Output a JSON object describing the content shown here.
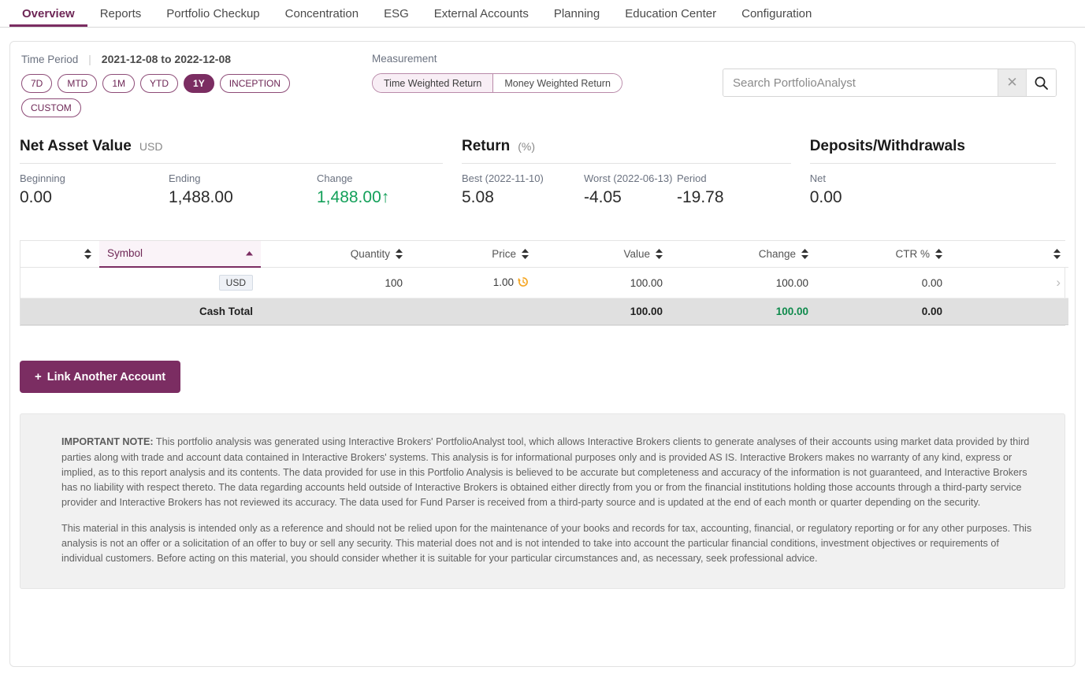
{
  "tabs": [
    {
      "label": "Overview",
      "active": true
    },
    {
      "label": "Reports",
      "active": false
    },
    {
      "label": "Portfolio Checkup",
      "active": false
    },
    {
      "label": "Concentration",
      "active": false
    },
    {
      "label": "ESG",
      "active": false
    },
    {
      "label": "External Accounts",
      "active": false
    },
    {
      "label": "Planning",
      "active": false
    },
    {
      "label": "Education Center",
      "active": false
    },
    {
      "label": "Configuration",
      "active": false
    }
  ],
  "time_period": {
    "label": "Time Period",
    "range": "2021-12-08 to 2022-12-08",
    "chips": [
      "7D",
      "MTD",
      "1M",
      "YTD",
      "1Y",
      "INCEPTION",
      "CUSTOM"
    ],
    "selected": "1Y"
  },
  "measurement": {
    "label": "Measurement",
    "options": [
      "Time Weighted Return",
      "Money Weighted Return"
    ],
    "selected": "Time Weighted Return"
  },
  "search": {
    "placeholder": "Search PortfolioAnalyst",
    "value": "",
    "clear_icon": "close-icon",
    "search_icon": "search-icon"
  },
  "summary": {
    "nav": {
      "title": "Net Asset Value",
      "unit": "USD",
      "items": [
        {
          "label": "Beginning",
          "value": "0.00",
          "positive": false
        },
        {
          "label": "Ending",
          "value": "1,488.00",
          "positive": false
        },
        {
          "label": "Change",
          "value": "1,488.00↑",
          "positive": true
        }
      ]
    },
    "ret": {
      "title": "Return",
      "unit": "(%)",
      "items": [
        {
          "label": "Best (2022-11-10)",
          "value": "5.08",
          "positive": false
        },
        {
          "label": "Worst (2022-06-13)",
          "value": "-4.05",
          "positive": false
        },
        {
          "label": "Period",
          "value": "-19.78",
          "positive": false
        }
      ]
    },
    "dep": {
      "title": "Deposits/Withdrawals",
      "unit": "",
      "items": [
        {
          "label": "Net",
          "value": "0.00",
          "positive": false
        }
      ]
    }
  },
  "table": {
    "columns": [
      "Symbol",
      "Quantity",
      "Price",
      "Value",
      "Change",
      "CTR %"
    ],
    "sorted_column": "Symbol",
    "sort_direction": "asc",
    "rows": [
      {
        "symbol": "USD",
        "quantity": "100",
        "price": "1.00",
        "price_icon": "history-icon",
        "value": "100.00",
        "change": "100.00",
        "ctr": "0.00",
        "expand_icon": "chevron-right-icon"
      }
    ],
    "total_row": {
      "label": "Cash Total",
      "quantity": "",
      "price": "",
      "value": "100.00",
      "change": "100.00",
      "ctr": "0.00"
    }
  },
  "link_button": {
    "label": "Link Another Account",
    "icon": "plus-icon"
  },
  "disclaimer": {
    "heading": "IMPORTANT NOTE:",
    "paragraph1": " This portfolio analysis was generated using Interactive Brokers' PortfolioAnalyst tool, which allows Interactive Brokers clients to generate analyses of their accounts using market data provided by third parties along with trade and account data contained in Interactive Brokers' systems. This analysis is for informational purposes only and is provided AS IS. Interactive Brokers makes no warranty of any kind, express or implied, as to this report analysis and its contents. The data provided for use in this Portfolio Analysis is believed to be accurate but completeness and accuracy of the information is not guaranteed, and Interactive Brokers has no liability with respect thereto. The data regarding accounts held outside of Interactive Brokers is obtained either directly from you or from the financial institutions holding those accounts through a third-party service provider and Interactive Brokers has not reviewed its accuracy. The data used for Fund Parser is received from a third-party source and is updated at the end of each month or quarter depending on the security.",
    "paragraph2": "This material in this analysis is intended only as a reference and should not be relied upon for the maintenance of your books and records for tax, accounting, financial, or regulatory reporting or for any other purposes. This analysis is not an offer or a solicitation of an offer to buy or sell any security. This material does not and is not intended to take into account the particular financial conditions, investment objectives or requirements of individual customers. Before acting on this material, you should consider whether it is suitable for your particular circumstances and, as necessary, seek professional advice."
  },
  "colors": {
    "brand_purple": "#7b2d62",
    "positive_green": "#14a05a",
    "history_orange": "#f5a623"
  }
}
